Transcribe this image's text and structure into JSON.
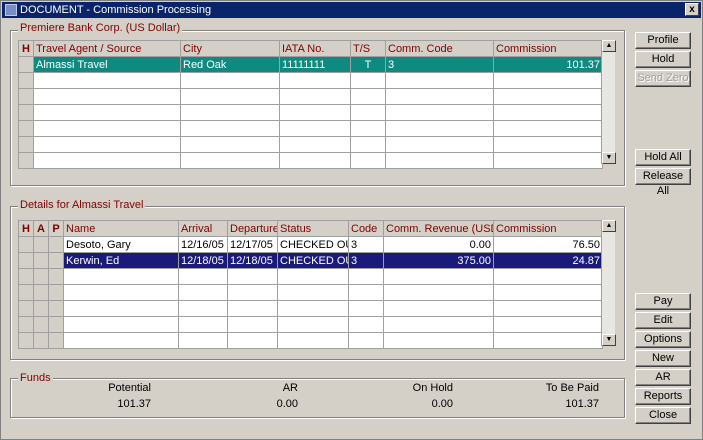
{
  "window": {
    "title": "DOCUMENT - Commission Processing",
    "close": "x"
  },
  "agents": {
    "group_title": "Premiere Bank Corp. (US Dollar)",
    "columns": [
      "H",
      "Travel Agent / Source",
      "City",
      "IATA No.",
      "T/S",
      "Comm. Code",
      "Commission"
    ],
    "rows": [
      {
        "name": "Almassi Travel",
        "city": "Red Oak",
        "iata": "11111111",
        "ts": "T",
        "code": "3",
        "commission": "101.37"
      }
    ]
  },
  "details": {
    "group_title": "Details for Almassi Travel",
    "columns": [
      "H",
      "A",
      "P",
      "Name",
      "Arrival",
      "Departure",
      "Status",
      "Code",
      "Comm. Revenue (USD)",
      "Commission"
    ],
    "rows": [
      {
        "name": "Desoto, Gary",
        "arrival": "12/16/05",
        "departure": "12/17/05",
        "status": "CHECKED OUT",
        "code": "3",
        "revenue": "0.00",
        "commission": "76.50"
      },
      {
        "name": "Kerwin, Ed",
        "arrival": "12/18/05",
        "departure": "12/18/05",
        "status": "CHECKED OUT",
        "code": "3",
        "revenue": "375.00",
        "commission": "24.87"
      }
    ]
  },
  "funds": {
    "group_title": "Funds",
    "potential_label": "Potential",
    "potential": "101.37",
    "ar_label": "AR",
    "ar": "0.00",
    "onhold_label": "On Hold",
    "onhold": "0.00",
    "tobepaid_label": "To Be Paid",
    "tobepaid": "101.37"
  },
  "buttons": {
    "profile": "Profile",
    "hold": "Hold",
    "send_zero": "Send Zero",
    "hold_all": "Hold All",
    "release_all": "Release All",
    "pay": "Pay",
    "edit": "Edit",
    "options": "Options",
    "new": "New",
    "ar": "AR",
    "reports": "Reports",
    "close": "Close"
  }
}
